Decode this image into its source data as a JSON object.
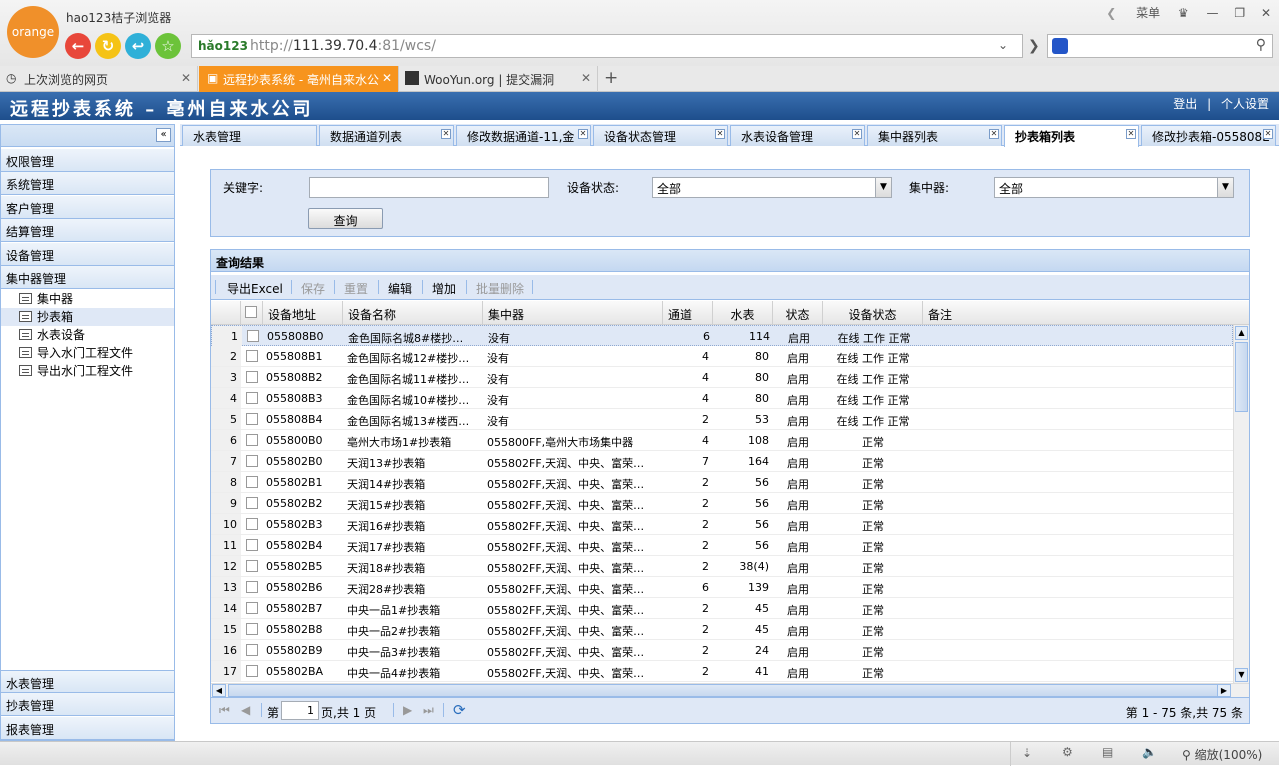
{
  "browser": {
    "logo_text": "orange",
    "title": "hao123桔子浏览器",
    "menu_label": "菜单",
    "address_logo": "hǎo123",
    "url_prefix": "http://",
    "url_host": "111.39.70.4",
    "url_rest": ":81/wcs/",
    "tabs": [
      {
        "label": "上次浏览的网页"
      },
      {
        "label": "远程抄表系统 - 亳州自来水公司"
      },
      {
        "label": "WooYun.org | 提交漏洞"
      }
    ],
    "status_zoom": "缩放(100%)"
  },
  "app": {
    "title": "远程抄表系统 – 亳州自来水公司",
    "logout": "登出",
    "separator": "|",
    "profile": "个人设置"
  },
  "sidebar": {
    "top_sections": [
      "权限管理",
      "系统管理",
      "客户管理",
      "结算管理",
      "设备管理",
      "集中器管理"
    ],
    "tree_items": [
      "集中器",
      "抄表箱",
      "水表设备",
      "导入水门工程文件",
      "导出水门工程文件"
    ],
    "bottom_sections": [
      "水表管理",
      "抄表管理",
      "报表管理"
    ]
  },
  "tabs": [
    "水表管理",
    "数据通道列表",
    "修改数据通道-11,金",
    "设备状态管理",
    "水表设备管理",
    "集中器列表",
    "抄表箱列表",
    "修改抄表箱-055808E"
  ],
  "query": {
    "keyword_label": "关键字:",
    "keyword_value": "",
    "status_label": "设备状态:",
    "status_value": "全部",
    "concentrator_label": "集中器:",
    "concentrator_value": "全部",
    "button": "查询"
  },
  "grid": {
    "title": "查询结果",
    "toolbar": [
      "导出Excel",
      "保存",
      "重置",
      "编辑",
      "增加",
      "批量删除"
    ],
    "columns": [
      "设备地址",
      "设备名称",
      "集中器",
      "通道",
      "水表",
      "状态",
      "设备状态",
      "备注"
    ],
    "rows": [
      [
        "1",
        "055808B0",
        "金色国际名城8#楼抄…",
        "没有",
        "6",
        "114",
        "启用",
        "在线 工作 正常"
      ],
      [
        "2",
        "055808B1",
        "金色国际名城12#楼抄…",
        "没有",
        "4",
        "80",
        "启用",
        "在线 工作 正常"
      ],
      [
        "3",
        "055808B2",
        "金色国际名城11#楼抄…",
        "没有",
        "4",
        "80",
        "启用",
        "在线 工作 正常"
      ],
      [
        "4",
        "055808B3",
        "金色国际名城10#楼抄…",
        "没有",
        "4",
        "80",
        "启用",
        "在线 工作 正常"
      ],
      [
        "5",
        "055808B4",
        "金色国际名城13#楼西…",
        "没有",
        "2",
        "53",
        "启用",
        "在线 工作 正常"
      ],
      [
        "6",
        "055800B0",
        "亳州大市场1#抄表箱",
        "055800FF,亳州大市场集中器",
        "4",
        "108",
        "启用",
        "正常"
      ],
      [
        "7",
        "055802B0",
        "天润13#抄表箱",
        "055802FF,天润、中央、富荣…",
        "7",
        "164",
        "启用",
        "正常"
      ],
      [
        "8",
        "055802B1",
        "天润14#抄表箱",
        "055802FF,天润、中央、富荣…",
        "2",
        "56",
        "启用",
        "正常"
      ],
      [
        "9",
        "055802B2",
        "天润15#抄表箱",
        "055802FF,天润、中央、富荣…",
        "2",
        "56",
        "启用",
        "正常"
      ],
      [
        "10",
        "055802B3",
        "天润16#抄表箱",
        "055802FF,天润、中央、富荣…",
        "2",
        "56",
        "启用",
        "正常"
      ],
      [
        "11",
        "055802B4",
        "天润17#抄表箱",
        "055802FF,天润、中央、富荣…",
        "2",
        "56",
        "启用",
        "正常"
      ],
      [
        "12",
        "055802B5",
        "天润18#抄表箱",
        "055802FF,天润、中央、富荣…",
        "2",
        "38(4)",
        "启用",
        "正常"
      ],
      [
        "13",
        "055802B6",
        "天润28#抄表箱",
        "055802FF,天润、中央、富荣…",
        "6",
        "139",
        "启用",
        "正常"
      ],
      [
        "14",
        "055802B7",
        "中央一品1#抄表箱",
        "055802FF,天润、中央、富荣…",
        "2",
        "45",
        "启用",
        "正常"
      ],
      [
        "15",
        "055802B8",
        "中央一品2#抄表箱",
        "055802FF,天润、中央、富荣…",
        "2",
        "45",
        "启用",
        "正常"
      ],
      [
        "16",
        "055802B9",
        "中央一品3#抄表箱",
        "055802FF,天润、中央、富荣…",
        "2",
        "24",
        "启用",
        "正常"
      ],
      [
        "17",
        "055802BA",
        "中央一品4#抄表箱",
        "055802FF,天润、中央、富荣…",
        "2",
        "41",
        "启用",
        "正常"
      ]
    ],
    "pager": {
      "page_prefix": "第",
      "page_value": "1",
      "page_suffix": "页,共 1 页",
      "summary": "第 1 - 75 条,共 75 条"
    }
  }
}
